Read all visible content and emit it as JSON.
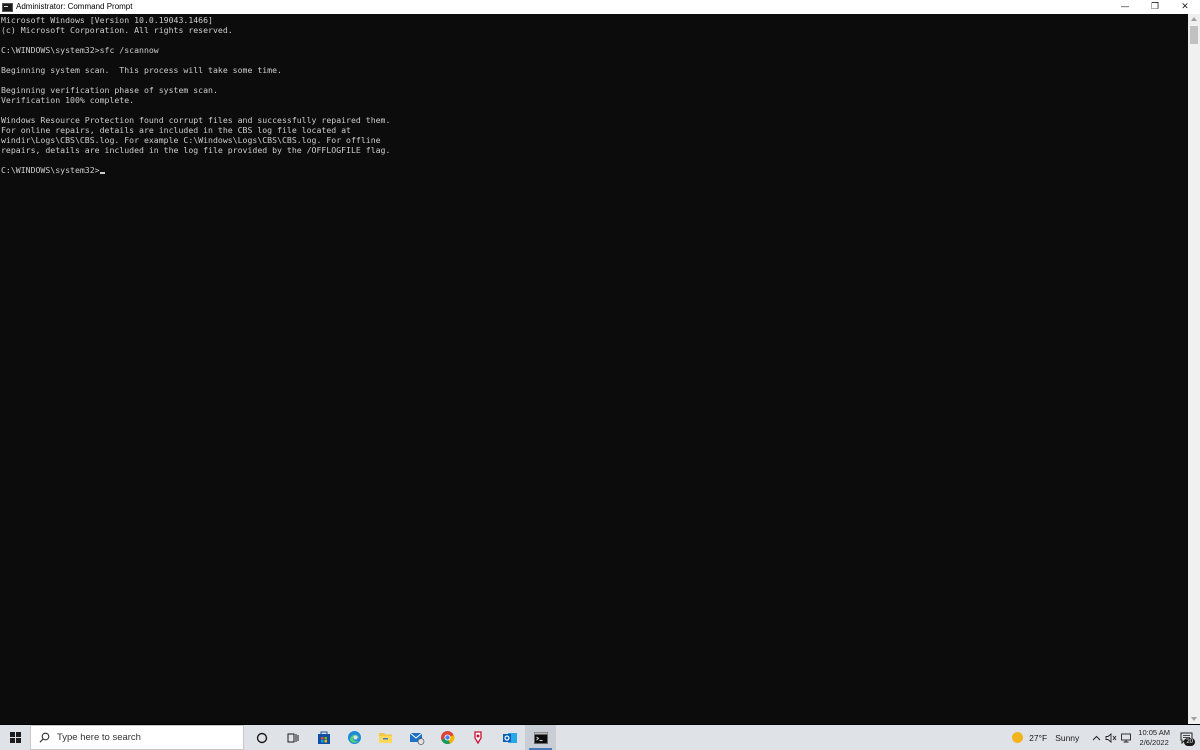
{
  "window": {
    "title": "Administrator: Command Prompt",
    "controls": {
      "minimize": "—",
      "restore": "❐",
      "close": "✕"
    }
  },
  "console": {
    "lines": [
      "Microsoft Windows [Version 10.0.19043.1466]",
      "(c) Microsoft Corporation. All rights reserved.",
      "",
      "C:\\WINDOWS\\system32>sfc /scannow",
      "",
      "Beginning system scan.  This process will take some time.",
      "",
      "Beginning verification phase of system scan.",
      "Verification 100% complete.",
      "",
      "Windows Resource Protection found corrupt files and successfully repaired them.",
      "For online repairs, details are included in the CBS log file located at",
      "windir\\Logs\\CBS\\CBS.log. For example C:\\Windows\\Logs\\CBS\\CBS.log. For offline",
      "repairs, details are included in the log file provided by the /OFFLOGFILE flag.",
      "",
      "C:\\WINDOWS\\system32>"
    ],
    "text_color": "#cccccc",
    "background": "#0c0c0c"
  },
  "taskbar": {
    "search_placeholder": "Type here to search",
    "apps": [
      {
        "name": "cortana-icon"
      },
      {
        "name": "task-view-icon"
      },
      {
        "name": "store-icon"
      },
      {
        "name": "edge-icon"
      },
      {
        "name": "file-explorer-icon"
      },
      {
        "name": "mail-icon"
      },
      {
        "name": "chrome-icon"
      },
      {
        "name": "paint-icon"
      },
      {
        "name": "outlook-icon"
      },
      {
        "name": "command-prompt-icon"
      }
    ],
    "weather": {
      "temp": "27°F",
      "condition": "Sunny"
    },
    "clock": {
      "time": "10:05 AM",
      "date": "2/6/2022"
    },
    "notification_count": "20"
  }
}
